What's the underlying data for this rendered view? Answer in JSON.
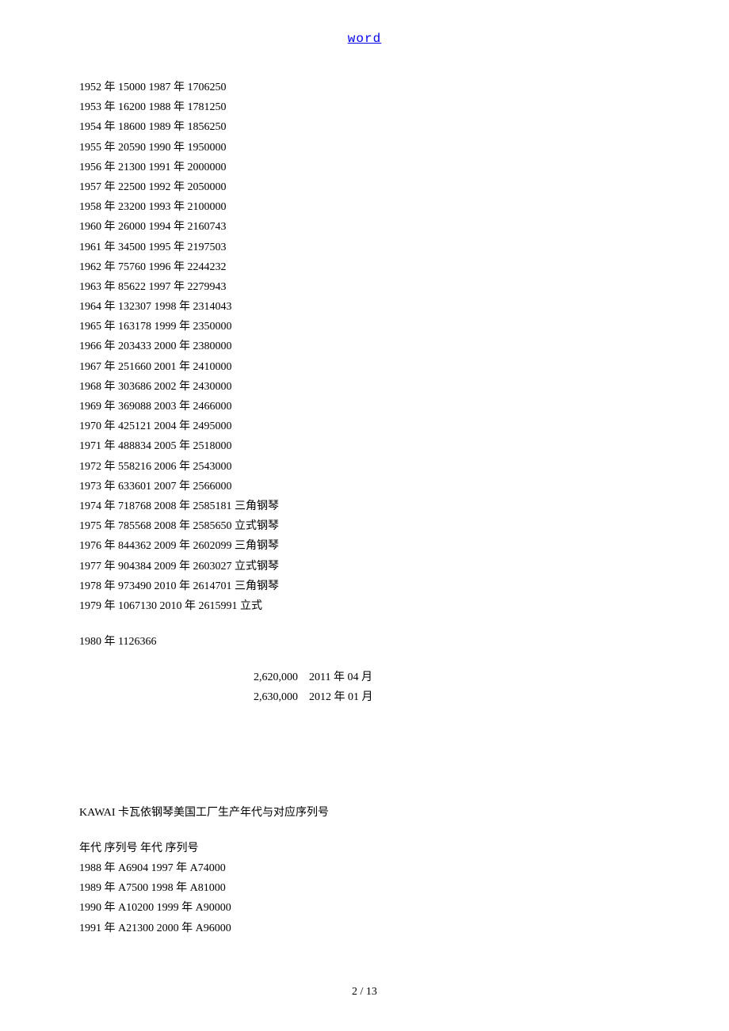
{
  "header": {
    "link_text": "word"
  },
  "serials_main": [
    "1952 年 15000 1987 年 1706250",
    "1953 年 16200 1988 年 1781250",
    "1954 年 18600 1989 年 1856250",
    "1955 年 20590 1990 年 1950000",
    "1956 年 21300 1991 年 2000000",
    "1957 年 22500 1992 年 2050000",
    "1958 年 23200 1993 年 2100000",
    "1960 年 26000 1994 年 2160743",
    "1961 年 34500 1995 年 2197503",
    "1962 年 75760 1996 年 2244232",
    "1963 年 85622 1997 年 2279943",
    "1964 年 132307 1998 年 2314043",
    "1965 年 163178 1999 年 2350000",
    "1966 年 203433 2000 年 2380000",
    "1967 年 251660 2001 年 2410000",
    "1968 年 303686 2002 年 2430000",
    "1969 年 369088 2003 年 2466000",
    "1970 年 425121 2004 年 2495000",
    "1971 年 488834 2005 年 2518000",
    "1972 年 558216 2006 年 2543000",
    "1973 年 633601 2007 年 2566000",
    "1974 年 718768 2008 年 2585181 三角钢琴",
    "1975 年 785568 2008 年 2585650 立式钢琴",
    "1976 年 844362 2009 年 2602099 三角钢琴",
    "1977 年 904384 2009 年 2603027 立式钢琴",
    "1978 年 973490 2010 年 2614701 三角钢琴",
    "1979 年 1067130 2010 年 2615991 立式"
  ],
  "serial_1980": "1980 年 1126366",
  "additional_serials": [
    "2,620,000    2011 年 04 月",
    "2,630,000    2012 年 01 月"
  ],
  "section2": {
    "title": "KAWAI 卡瓦依钢琴美国工厂生产年代与对应序列号",
    "header_row": "年代 序列号 年代 序列号",
    "rows": [
      "1988 年 A6904 1997 年 A74000",
      "1989 年 A7500 1998 年 A81000",
      "1990 年 A10200 1999 年 A90000",
      "1991 年 A21300 2000 年 A96000"
    ]
  },
  "footer": {
    "page_text": "2 / 13"
  }
}
